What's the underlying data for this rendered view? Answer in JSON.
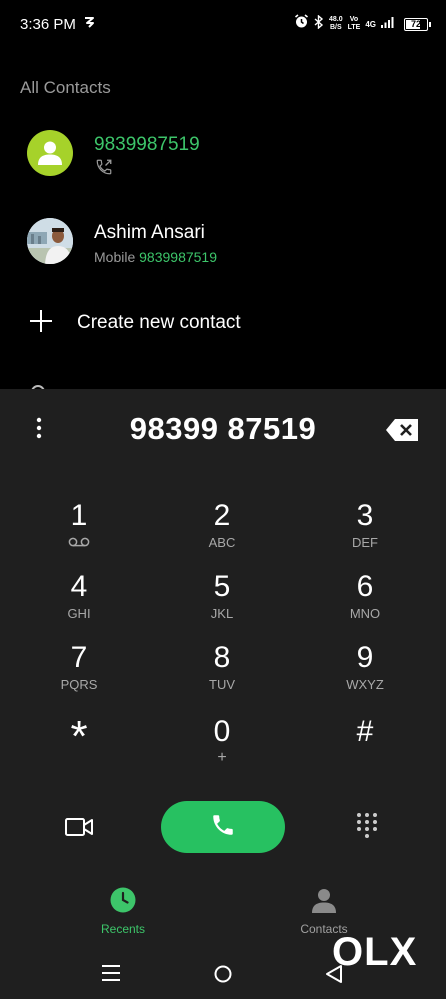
{
  "status_bar": {
    "time": "3:36 PM",
    "net_speed_value": "48.0",
    "net_speed_unit": "B/S",
    "volte_top": "Vo",
    "volte_bottom": "LTE",
    "network": "4G",
    "battery_level": "72",
    "battery_fraction": 0.72,
    "icons": [
      "wind-icon",
      "alarm-icon",
      "bluetooth-icon",
      "signal-icon"
    ]
  },
  "contacts": {
    "section_title": "All Contacts",
    "items": [
      {
        "name": "9839987519",
        "avatar": "person-icon",
        "sub_icon": "outgoing-call-icon"
      },
      {
        "name": "Ashim Ansari",
        "sub_label": "Mobile",
        "sub_number": "9839987519",
        "avatar": "photo"
      }
    ],
    "create_label": "Create new contact"
  },
  "dialer": {
    "number": "98399 87519",
    "keys": [
      {
        "digit": "1",
        "letters": "",
        "icon": "voicemail-icon"
      },
      {
        "digit": "2",
        "letters": "ABC"
      },
      {
        "digit": "3",
        "letters": "DEF"
      },
      {
        "digit": "4",
        "letters": "GHI"
      },
      {
        "digit": "5",
        "letters": "JKL"
      },
      {
        "digit": "6",
        "letters": "MNO"
      },
      {
        "digit": "7",
        "letters": "PQRS"
      },
      {
        "digit": "8",
        "letters": "TUV"
      },
      {
        "digit": "9",
        "letters": "WXYZ"
      },
      {
        "digit": "*",
        "letters": ""
      },
      {
        "digit": "0",
        "letters": "+"
      },
      {
        "digit": "#",
        "letters": ""
      }
    ]
  },
  "tabs": {
    "recents": "Recents",
    "contacts": "Contacts"
  },
  "watermark": {
    "letters": [
      "O",
      "L",
      "X"
    ]
  },
  "colors": {
    "accent_green": "#3dc56a",
    "call_button": "#27c161",
    "avatar_green": "#a6d22a",
    "panel_bg": "#1f1f1f"
  }
}
